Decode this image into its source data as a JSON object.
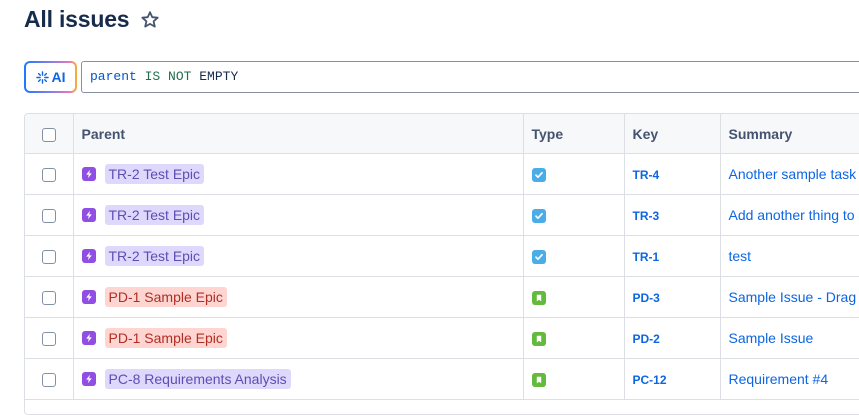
{
  "header": {
    "title": "All issues",
    "star_icon": "star-icon"
  },
  "query": {
    "ai_label": "AI",
    "ai_icon": "sparkle-icon",
    "field": "parent",
    "operator": "IS NOT",
    "value": "EMPTY"
  },
  "table": {
    "columns": {
      "parent": "Parent",
      "type": "Type",
      "key": "Key",
      "summary": "Summary"
    },
    "rows": [
      {
        "parent": "TR-2 Test Epic",
        "parent_color": "purple",
        "type": "task",
        "key": "TR-4",
        "summary": "Another sample task"
      },
      {
        "parent": "TR-2 Test Epic",
        "parent_color": "purple",
        "type": "task",
        "key": "TR-3",
        "summary": "Add another thing to"
      },
      {
        "parent": "TR-2 Test Epic",
        "parent_color": "purple",
        "type": "task",
        "key": "TR-1",
        "summary": "test"
      },
      {
        "parent": "PD-1 Sample Epic",
        "parent_color": "red",
        "type": "story",
        "key": "PD-3",
        "summary": "Sample Issue - Drag C"
      },
      {
        "parent": "PD-1 Sample Epic",
        "parent_color": "red",
        "type": "story",
        "key": "PD-2",
        "summary": "Sample Issue"
      },
      {
        "parent": "PC-8 Requirements Analysis",
        "parent_color": "purple",
        "type": "story",
        "key": "PC-12",
        "summary": "Requirement #4"
      }
    ]
  },
  "colors": {
    "accent": "#0c66e4",
    "epic_icon": "#904ee2",
    "task_icon": "#4bade8",
    "story_icon": "#63ba3c",
    "lozenge_purple_bg": "#dfd8fd",
    "lozenge_red_bg": "#ffd5d2"
  }
}
